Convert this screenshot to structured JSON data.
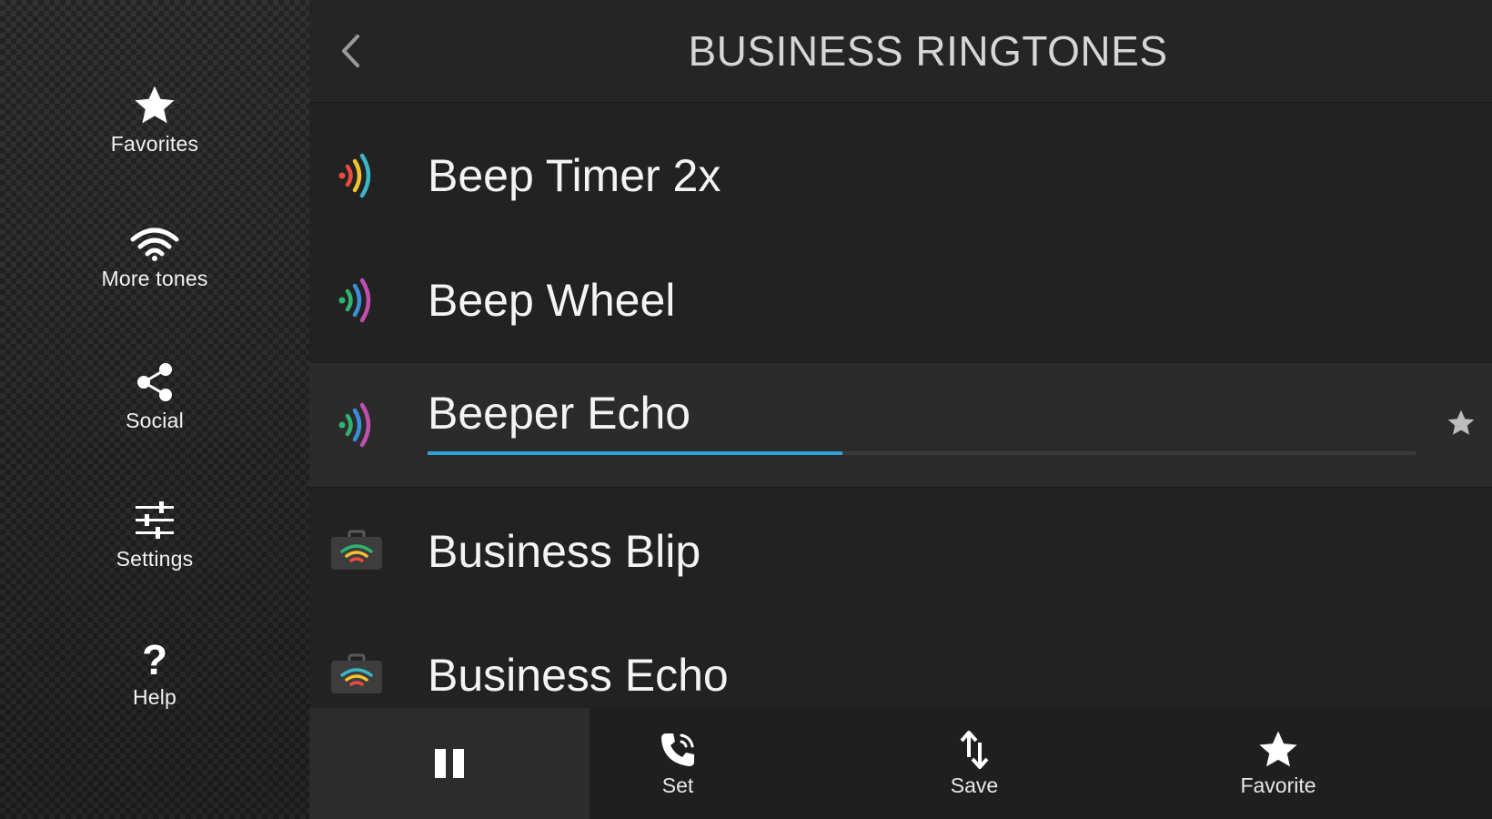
{
  "sidebar": {
    "items": [
      {
        "label": "Favorites",
        "icon": "star-icon"
      },
      {
        "label": "More tones",
        "icon": "wifi-icon"
      },
      {
        "label": "Social",
        "icon": "share-icon"
      },
      {
        "label": "Settings",
        "icon": "sliders-icon"
      },
      {
        "label": "Help",
        "icon": "question-icon"
      }
    ]
  },
  "header": {
    "title": "BUSINESS RINGTONES",
    "back_icon": "chevron-left-icon"
  },
  "ringtones": [
    {
      "title": "Beep Timer 2x",
      "icon": "sound-wave-icon"
    },
    {
      "title": "Beep Wheel",
      "icon": "sound-wave-icon"
    },
    {
      "title": "Beeper Echo",
      "icon": "sound-wave-icon",
      "playing": true,
      "progress": 0.42
    },
    {
      "title": "Business Blip",
      "icon": "briefcase-wave-icon"
    },
    {
      "title": "Business Echo",
      "icon": "briefcase-wave-icon"
    }
  ],
  "bottom_bar": {
    "play_icon": "pause-icon",
    "set_label": "Set",
    "save_label": "Save",
    "favorite_label": "Favorite"
  },
  "colors": {
    "accent": "#2fa3d9",
    "background": "#222222",
    "sidebar": "#2b2b2b",
    "active_row": "#2b2b2b"
  }
}
